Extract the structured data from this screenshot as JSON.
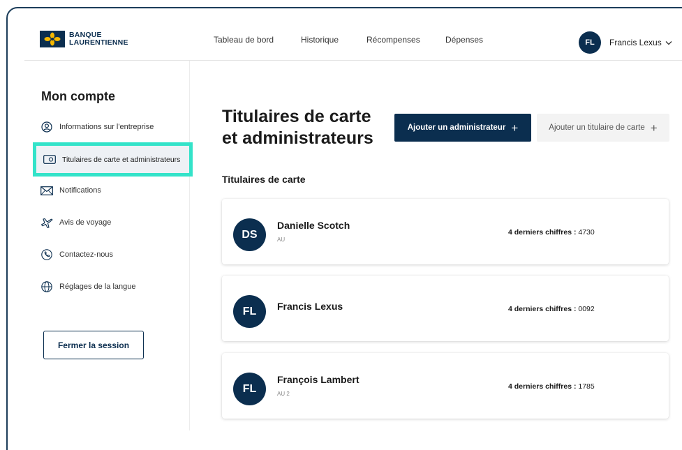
{
  "header": {
    "logo_line1": "BANQUE",
    "logo_line2": "LAURENTIENNE",
    "nav": [
      "Tableau de bord",
      "Historique",
      "Récompenses",
      "Dépenses"
    ],
    "user_initials": "FL",
    "user_name": "Francis Lexus"
  },
  "sidebar": {
    "title": "Mon compte",
    "items": [
      {
        "label": "Informations sur l'entreprise",
        "icon": "user-circle-icon"
      },
      {
        "label": "Titulaires de carte et administrateurs",
        "icon": "card-icon",
        "active": true
      },
      {
        "label": "Notifications",
        "icon": "envelope-icon"
      },
      {
        "label": "Avis de voyage",
        "icon": "airplane-icon"
      },
      {
        "label": "Contactez-nous",
        "icon": "phone-icon"
      },
      {
        "label": "Réglages de la langue",
        "icon": "globe-icon"
      }
    ],
    "logout_label": "Fermer la session"
  },
  "main": {
    "title_line1": "Titulaires de carte",
    "title_line2": "et administrateurs",
    "add_admin_label": "Ajouter un administrateur",
    "add_holder_label": "Ajouter un titulaire de carte",
    "section_title": "Titulaires de carte",
    "digits_label": "4 derniers chiffres :",
    "cards": [
      {
        "initials": "DS",
        "name": "Danielle Scotch",
        "sub": "AU",
        "digits": "4730"
      },
      {
        "initials": "FL",
        "name": "Francis Lexus",
        "sub": "",
        "digits": "0092"
      },
      {
        "initials": "FL",
        "name": "François Lambert",
        "sub": "AU 2",
        "digits": "1785"
      }
    ]
  },
  "colors": {
    "brand_navy": "#0b2e4f",
    "highlight": "#33e3c9",
    "logo_yellow": "#f5b800"
  }
}
